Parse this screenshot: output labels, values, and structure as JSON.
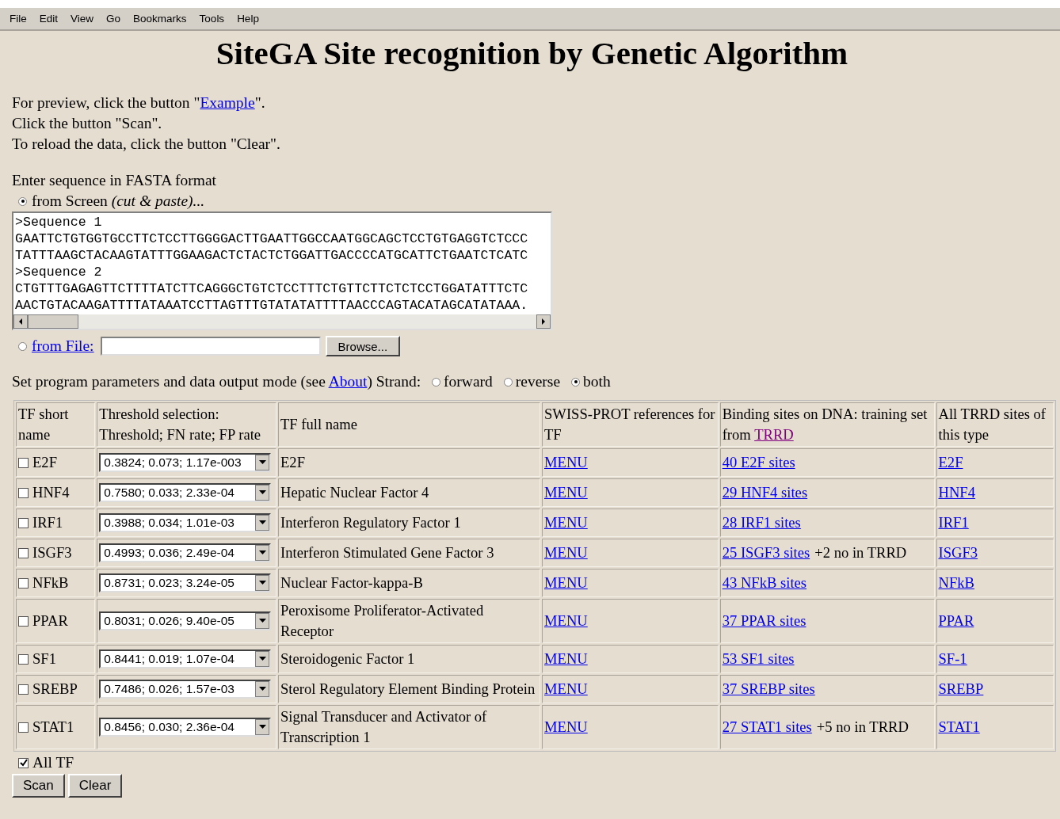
{
  "menu_bar": [
    "File",
    "Edit",
    "View",
    "Go",
    "Bookmarks",
    "Tools",
    "Help"
  ],
  "title": "SiteGA Site recognition by Genetic Algorithm",
  "instructions": [
    {
      "before": "For preview, click the button \"",
      "link": "Example",
      "after": "\"."
    },
    {
      "before": "Click the button  \"Scan\"."
    },
    {
      "before": "To reload the data, click the button \"Clear\"."
    }
  ],
  "sequence_label": "Enter sequence in FASTA format",
  "from_screen": {
    "label": "from Screen *(cut & paste)...*",
    "selected": true
  },
  "sequence_lines": [
    ">Sequence 1",
    "GAATTCTGTGGTGCCTTCTCCTTGGGGACTTGAATTGGCCAATGGCAGCTCCTGTGAGGTCTCCC",
    "TATTTAAGCTACAAGTATTTGGAAGACTCTACTCTGGATTGACCCCATGCATTCTGAATCTCATC",
    ">Sequence 2",
    "CTGTTTGAGAGTTCTTTTATCTTCAGGGCTGTCTCCTTTCTGTTCTTCTCTCCTGGATATTTCTC",
    "AACTGTACAAGATTTTATAAATCCTTAGTTTGTATATATTTTAACCCAGTACATAGCATATAAA."
  ],
  "from_file": {
    "label": "from File:",
    "selected": false,
    "browse_button": "Browse..."
  },
  "params": {
    "before": "Set program parameters and data output mode (see ",
    "link": "About",
    "after": ") Strand:"
  },
  "strand_options": [
    {
      "label": "forward",
      "selected": false
    },
    {
      "label": "reverse",
      "selected": false
    },
    {
      "label": "both",
      "selected": true
    }
  ],
  "table": {
    "columns": [
      "TF short name",
      "Threshold selection: Threshold; FN rate; FP rate",
      "TF full name",
      "SWISS-PROT references for TF",
      {
        "text": "Binding sites on DNA: training set from ",
        "link": "TRRD"
      },
      "All TRRD sites of this type"
    ],
    "rows": [
      {
        "short": "E2F",
        "checked": false,
        "threshold": "0.3824; 0.073; 1.17e-003",
        "full": "E2F",
        "ref": "MENU",
        "sites": "40 E2F sites",
        "trrd": "E2F"
      },
      {
        "short": "HNF4",
        "checked": false,
        "threshold": "0.7580; 0.033; 2.33e-04",
        "full": "Hepatic Nuclear Factor 4",
        "ref": "MENU",
        "sites": "29 HNF4 sites",
        "trrd": "HNF4"
      },
      {
        "short": "IRF1",
        "checked": false,
        "threshold": "0.3988; 0.034; 1.01e-03",
        "full": "Interferon Regulatory Factor 1",
        "ref": "MENU",
        "sites": "28 IRF1 sites",
        "trrd": "IRF1"
      },
      {
        "short": "ISGF3",
        "checked": false,
        "threshold": "0.4993; 0.036; 2.49e-04",
        "full": "Interferon Stimulated Gene Factor 3",
        "ref": "MENU",
        "sites": "25 ISGF3 sites",
        "extra": "+2 no in TRRD",
        "trrd": "ISGF3"
      },
      {
        "short": "NFkB",
        "checked": false,
        "threshold": "0.8731; 0.023; 3.24e-05",
        "full": "Nuclear Factor-kappa-B",
        "ref": "MENU",
        "sites": "43 NFkB sites",
        "trrd": "NFkB"
      },
      {
        "short": "PPAR",
        "checked": false,
        "threshold": "0.8031; 0.026; 9.40e-05",
        "full": "Peroxisome Proliferator-Activated Receptor",
        "ref": "MENU",
        "sites": "37 PPAR sites",
        "trrd": "PPAR"
      },
      {
        "short": "SF1",
        "checked": false,
        "threshold": "0.8441; 0.019; 1.07e-04",
        "full": "Steroidogenic Factor 1",
        "ref": "MENU",
        "sites": "53 SF1 sites",
        "trrd": "SF-1"
      },
      {
        "short": "SREBP",
        "checked": false,
        "threshold": "0.7486; 0.026; 1.57e-03",
        "full": "Sterol Regulatory Element Binding Protein",
        "ref": "MENU",
        "sites": "37 SREBP sites",
        "trrd": "SREBP"
      },
      {
        "short": "STAT1",
        "checked": false,
        "threshold": "0.8456; 0.030; 2.36e-04",
        "full": "Signal Transducer and Activator of Transcription 1",
        "ref": "MENU",
        "sites": "27 STAT1 sites",
        "extra": "+5 no in TRRD",
        "trrd": "STAT1"
      }
    ]
  },
  "all_tf": {
    "label": "All TF",
    "checked": true
  },
  "buttons": [
    "Scan",
    "Clear"
  ]
}
